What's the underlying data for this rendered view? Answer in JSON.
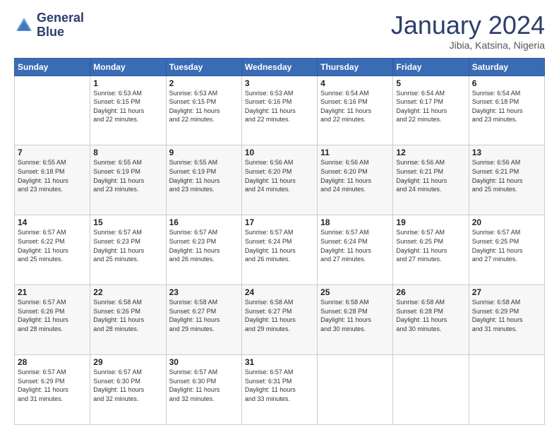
{
  "logo": {
    "general": "General",
    "blue": "Blue"
  },
  "header": {
    "month": "January 2024",
    "location": "Jibia, Katsina, Nigeria"
  },
  "weekdays": [
    "Sunday",
    "Monday",
    "Tuesday",
    "Wednesday",
    "Thursday",
    "Friday",
    "Saturday"
  ],
  "weeks": [
    [
      {
        "day": "",
        "content": ""
      },
      {
        "day": "1",
        "content": "Sunrise: 6:53 AM\nSunset: 6:15 PM\nDaylight: 11 hours\nand 22 minutes."
      },
      {
        "day": "2",
        "content": "Sunrise: 6:53 AM\nSunset: 6:15 PM\nDaylight: 11 hours\nand 22 minutes."
      },
      {
        "day": "3",
        "content": "Sunrise: 6:53 AM\nSunset: 6:16 PM\nDaylight: 11 hours\nand 22 minutes."
      },
      {
        "day": "4",
        "content": "Sunrise: 6:54 AM\nSunset: 6:16 PM\nDaylight: 11 hours\nand 22 minutes."
      },
      {
        "day": "5",
        "content": "Sunrise: 6:54 AM\nSunset: 6:17 PM\nDaylight: 11 hours\nand 22 minutes."
      },
      {
        "day": "6",
        "content": "Sunrise: 6:54 AM\nSunset: 6:18 PM\nDaylight: 11 hours\nand 23 minutes."
      }
    ],
    [
      {
        "day": "7",
        "content": "Sunrise: 6:55 AM\nSunset: 6:18 PM\nDaylight: 11 hours\nand 23 minutes."
      },
      {
        "day": "8",
        "content": "Sunrise: 6:55 AM\nSunset: 6:19 PM\nDaylight: 11 hours\nand 23 minutes."
      },
      {
        "day": "9",
        "content": "Sunrise: 6:55 AM\nSunset: 6:19 PM\nDaylight: 11 hours\nand 23 minutes."
      },
      {
        "day": "10",
        "content": "Sunrise: 6:56 AM\nSunset: 6:20 PM\nDaylight: 11 hours\nand 24 minutes."
      },
      {
        "day": "11",
        "content": "Sunrise: 6:56 AM\nSunset: 6:20 PM\nDaylight: 11 hours\nand 24 minutes."
      },
      {
        "day": "12",
        "content": "Sunrise: 6:56 AM\nSunset: 6:21 PM\nDaylight: 11 hours\nand 24 minutes."
      },
      {
        "day": "13",
        "content": "Sunrise: 6:56 AM\nSunset: 6:21 PM\nDaylight: 11 hours\nand 25 minutes."
      }
    ],
    [
      {
        "day": "14",
        "content": "Sunrise: 6:57 AM\nSunset: 6:22 PM\nDaylight: 11 hours\nand 25 minutes."
      },
      {
        "day": "15",
        "content": "Sunrise: 6:57 AM\nSunset: 6:23 PM\nDaylight: 11 hours\nand 25 minutes."
      },
      {
        "day": "16",
        "content": "Sunrise: 6:57 AM\nSunset: 6:23 PM\nDaylight: 11 hours\nand 26 minutes."
      },
      {
        "day": "17",
        "content": "Sunrise: 6:57 AM\nSunset: 6:24 PM\nDaylight: 11 hours\nand 26 minutes."
      },
      {
        "day": "18",
        "content": "Sunrise: 6:57 AM\nSunset: 6:24 PM\nDaylight: 11 hours\nand 27 minutes."
      },
      {
        "day": "19",
        "content": "Sunrise: 6:57 AM\nSunset: 6:25 PM\nDaylight: 11 hours\nand 27 minutes."
      },
      {
        "day": "20",
        "content": "Sunrise: 6:57 AM\nSunset: 6:25 PM\nDaylight: 11 hours\nand 27 minutes."
      }
    ],
    [
      {
        "day": "21",
        "content": "Sunrise: 6:57 AM\nSunset: 6:26 PM\nDaylight: 11 hours\nand 28 minutes."
      },
      {
        "day": "22",
        "content": "Sunrise: 6:58 AM\nSunset: 6:26 PM\nDaylight: 11 hours\nand 28 minutes."
      },
      {
        "day": "23",
        "content": "Sunrise: 6:58 AM\nSunset: 6:27 PM\nDaylight: 11 hours\nand 29 minutes."
      },
      {
        "day": "24",
        "content": "Sunrise: 6:58 AM\nSunset: 6:27 PM\nDaylight: 11 hours\nand 29 minutes."
      },
      {
        "day": "25",
        "content": "Sunrise: 6:58 AM\nSunset: 6:28 PM\nDaylight: 11 hours\nand 30 minutes."
      },
      {
        "day": "26",
        "content": "Sunrise: 6:58 AM\nSunset: 6:28 PM\nDaylight: 11 hours\nand 30 minutes."
      },
      {
        "day": "27",
        "content": "Sunrise: 6:58 AM\nSunset: 6:29 PM\nDaylight: 11 hours\nand 31 minutes."
      }
    ],
    [
      {
        "day": "28",
        "content": "Sunrise: 6:57 AM\nSunset: 6:29 PM\nDaylight: 11 hours\nand 31 minutes."
      },
      {
        "day": "29",
        "content": "Sunrise: 6:57 AM\nSunset: 6:30 PM\nDaylight: 11 hours\nand 32 minutes."
      },
      {
        "day": "30",
        "content": "Sunrise: 6:57 AM\nSunset: 6:30 PM\nDaylight: 11 hours\nand 32 minutes."
      },
      {
        "day": "31",
        "content": "Sunrise: 6:57 AM\nSunset: 6:31 PM\nDaylight: 11 hours\nand 33 minutes."
      },
      {
        "day": "",
        "content": ""
      },
      {
        "day": "",
        "content": ""
      },
      {
        "day": "",
        "content": ""
      }
    ]
  ]
}
